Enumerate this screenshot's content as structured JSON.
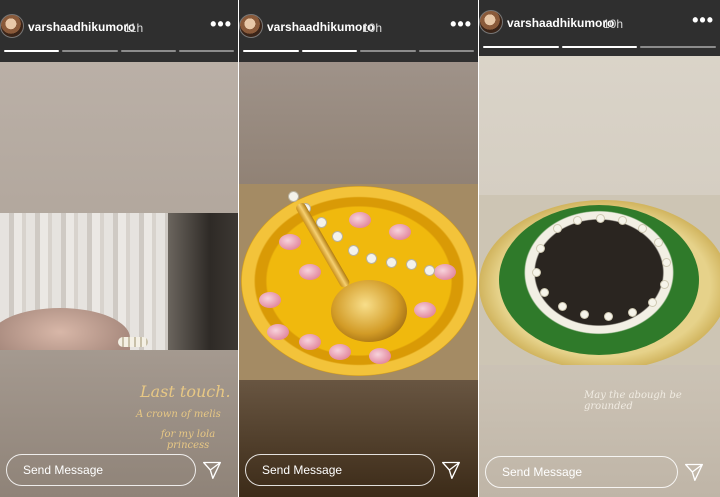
{
  "stories": [
    {
      "username": "varshaadhikumoro",
      "time": "11h",
      "more": "•••",
      "progress_segments": 4,
      "progress_active": 0,
      "caption_title": "Last touch.",
      "caption_line2": "A crown of melis",
      "caption_line3": "for my lola princess",
      "send_placeholder": "Send Message",
      "icons": [
        "more-icon",
        "send-icon"
      ]
    },
    {
      "username": "varshaadhikumoro",
      "time": "10h",
      "more": "•••",
      "progress_segments": 4,
      "progress_active": 1,
      "send_placeholder": "Send Message",
      "icons": [
        "more-icon",
        "send-icon"
      ]
    },
    {
      "username": "varshaadhikumoro",
      "time": "10h",
      "more": "•••",
      "progress_segments": 3,
      "progress_active": 1,
      "caption": "May the abough be grounded",
      "send_placeholder": "Send Message",
      "icons": [
        "more-icon",
        "send-icon"
      ]
    }
  ]
}
